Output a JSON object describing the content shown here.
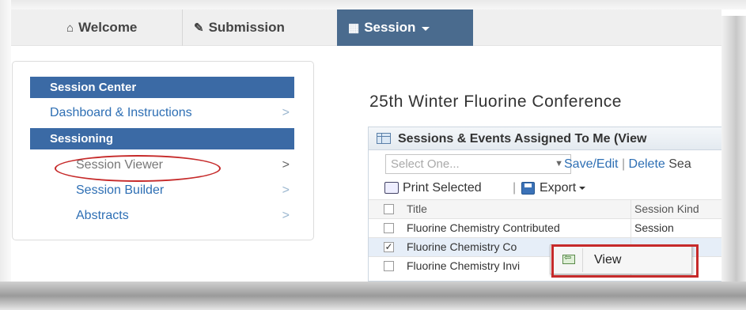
{
  "nav": {
    "tabs": [
      {
        "label": "Welcome",
        "icon": "home-icon"
      },
      {
        "label": "Submission",
        "icon": "pencil-icon"
      },
      {
        "label": "Session",
        "icon": "calendar-icon",
        "active": true
      }
    ],
    "active_color": "#4a6b8e"
  },
  "sidebar": {
    "header1": "Session Center",
    "item_dashboard": "Dashboard & Instructions",
    "header2": "Sessioning",
    "item_viewer": "Session Viewer",
    "item_builder": "Session Builder",
    "item_abstracts": "Abstracts",
    "header_color": "#3b6aa5",
    "chevron": ">"
  },
  "main": {
    "title": "25th Winter Fluorine Conference",
    "panel_title": "Sessions & Events Assigned To Me (View",
    "select_placeholder": "Select One...",
    "save_edit": "Save/Edit",
    "delete": "Delete",
    "search_partial": "Sea",
    "print_selected": "Print Selected",
    "export": "Export",
    "table": {
      "headers": [
        "Title",
        "Session Kind"
      ],
      "rows": [
        {
          "title": "Fluorine Chemistry Contributed",
          "kind": "Session",
          "checked": false
        },
        {
          "title": "Fluorine Chemistry Co",
          "kind": "",
          "checked": true
        },
        {
          "title": "Fluorine Chemistry Invi",
          "kind": "",
          "checked": false
        }
      ]
    }
  },
  "context_menu": {
    "view_label": "View",
    "icon": "view-icon"
  },
  "highlight_color": "#c62a2a"
}
